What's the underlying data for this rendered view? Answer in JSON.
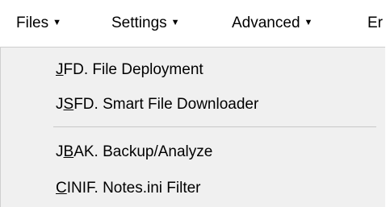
{
  "menubar": {
    "items": [
      {
        "label": "Files",
        "caret": "▼"
      },
      {
        "label": "Settings",
        "caret": "▼"
      },
      {
        "label": "Advanced",
        "caret": "▼"
      },
      {
        "label": "Er",
        "caret": ""
      }
    ]
  },
  "files_menu": {
    "items": [
      {
        "mnemonic": "J",
        "rest": "FD. File Deployment"
      },
      {
        "pre": "J",
        "mnemonic": "S",
        "rest": "FD. Smart File Downloader"
      },
      {
        "pre": "J",
        "mnemonic": "B",
        "rest": "AK. Backup/Analyze"
      },
      {
        "mnemonic": "C",
        "rest": "INIF. Notes.ini Filter"
      }
    ]
  },
  "colors": {
    "menu_background": "#f0f0f0",
    "menubar_background": "#ffffff",
    "separator": "#c8c8c8",
    "text": "#000000"
  }
}
